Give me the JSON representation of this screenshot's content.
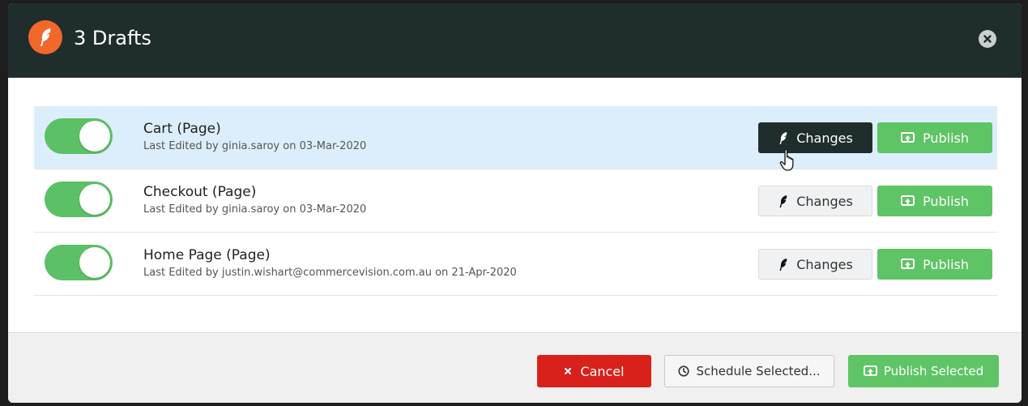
{
  "header": {
    "title": "3 Drafts",
    "logo_icon": "feather-icon",
    "close_icon": "close-circle-icon"
  },
  "drafts": [
    {
      "title": "Cart (Page)",
      "subtitle": "Last Edited by ginia.saroy on 03-Mar-2020",
      "toggle_on": true,
      "changes_label": "Changes",
      "publish_label": "Publish",
      "selected": true
    },
    {
      "title": "Checkout (Page)",
      "subtitle": "Last Edited by ginia.saroy on 03-Mar-2020",
      "toggle_on": true,
      "changes_label": "Changes",
      "publish_label": "Publish",
      "selected": false
    },
    {
      "title": "Home Page (Page)",
      "subtitle": "Last Edited by justin.wishart@commercevision.com.au on 21-Apr-2020",
      "toggle_on": true,
      "changes_label": "Changes",
      "publish_label": "Publish",
      "selected": false
    }
  ],
  "footer": {
    "cancel_label": "Cancel",
    "schedule_label": "Schedule Selected...",
    "publish_selected_label": "Publish Selected"
  },
  "colors": {
    "header_bg": "#1f2d2c",
    "accent_orange": "#f0682a",
    "publish_green": "#5ec465",
    "toggle_green": "#5cc066",
    "cancel_red": "#d8211b",
    "selected_row_bg": "#dceefb"
  }
}
